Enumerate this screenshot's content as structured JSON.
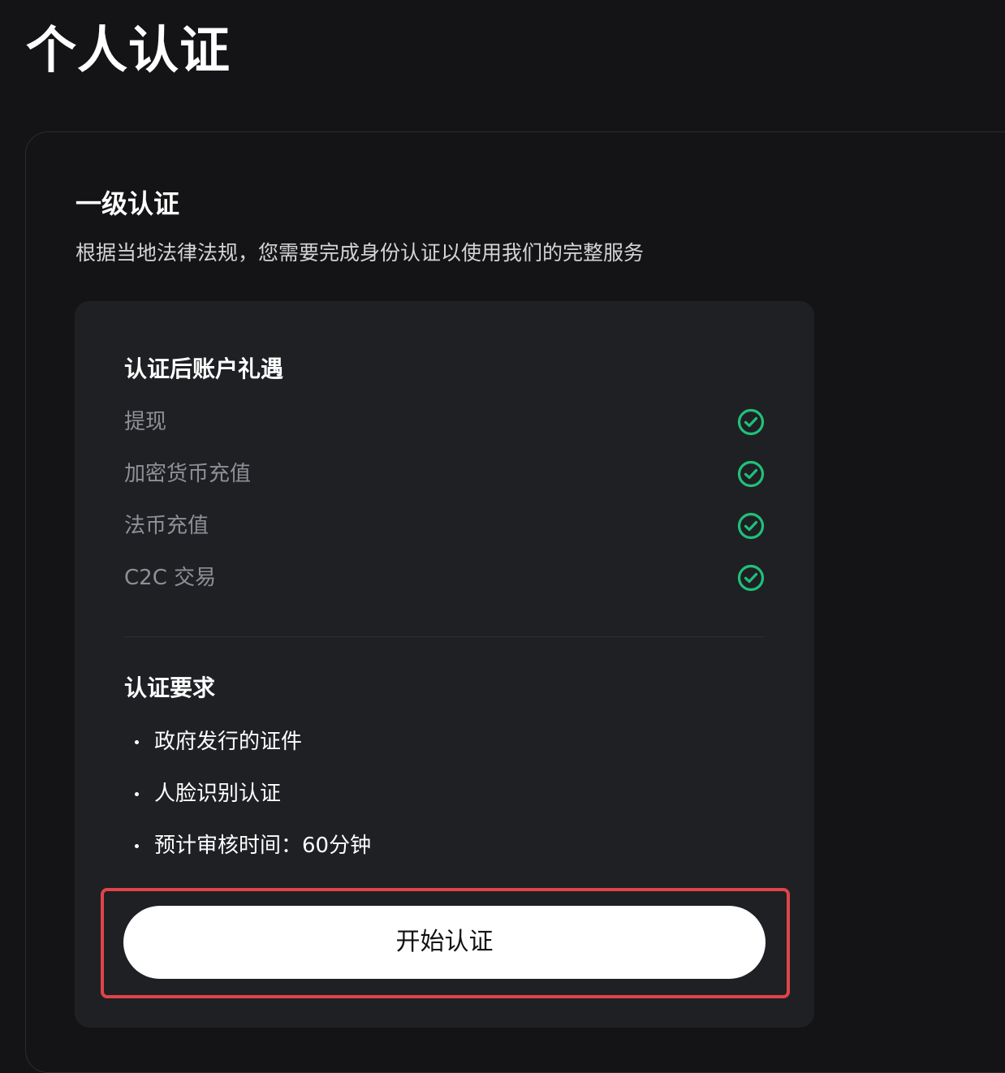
{
  "page": {
    "title": "个人认证"
  },
  "level": {
    "title": "一级认证",
    "description": "根据当地法律法规，您需要完成身份认证以使用我们的完整服务"
  },
  "benefits": {
    "title": "认证后账户礼遇",
    "items": [
      {
        "label": "提现",
        "icon": "check-circle-icon"
      },
      {
        "label": "加密货币充值",
        "icon": "check-circle-icon"
      },
      {
        "label": "法币充值",
        "icon": "check-circle-icon"
      },
      {
        "label": "C2C 交易",
        "icon": "check-circle-icon"
      }
    ]
  },
  "requirements": {
    "title": "认证要求",
    "items": [
      "政府发行的证件",
      "人脸识别认证",
      "预计审核时间：60分钟"
    ]
  },
  "action": {
    "start_label": "开始认证"
  },
  "colors": {
    "background": "#141416",
    "panel": "#1f2024",
    "check": "#20c07a",
    "highlight": "#e04448",
    "button": "#ffffff"
  }
}
